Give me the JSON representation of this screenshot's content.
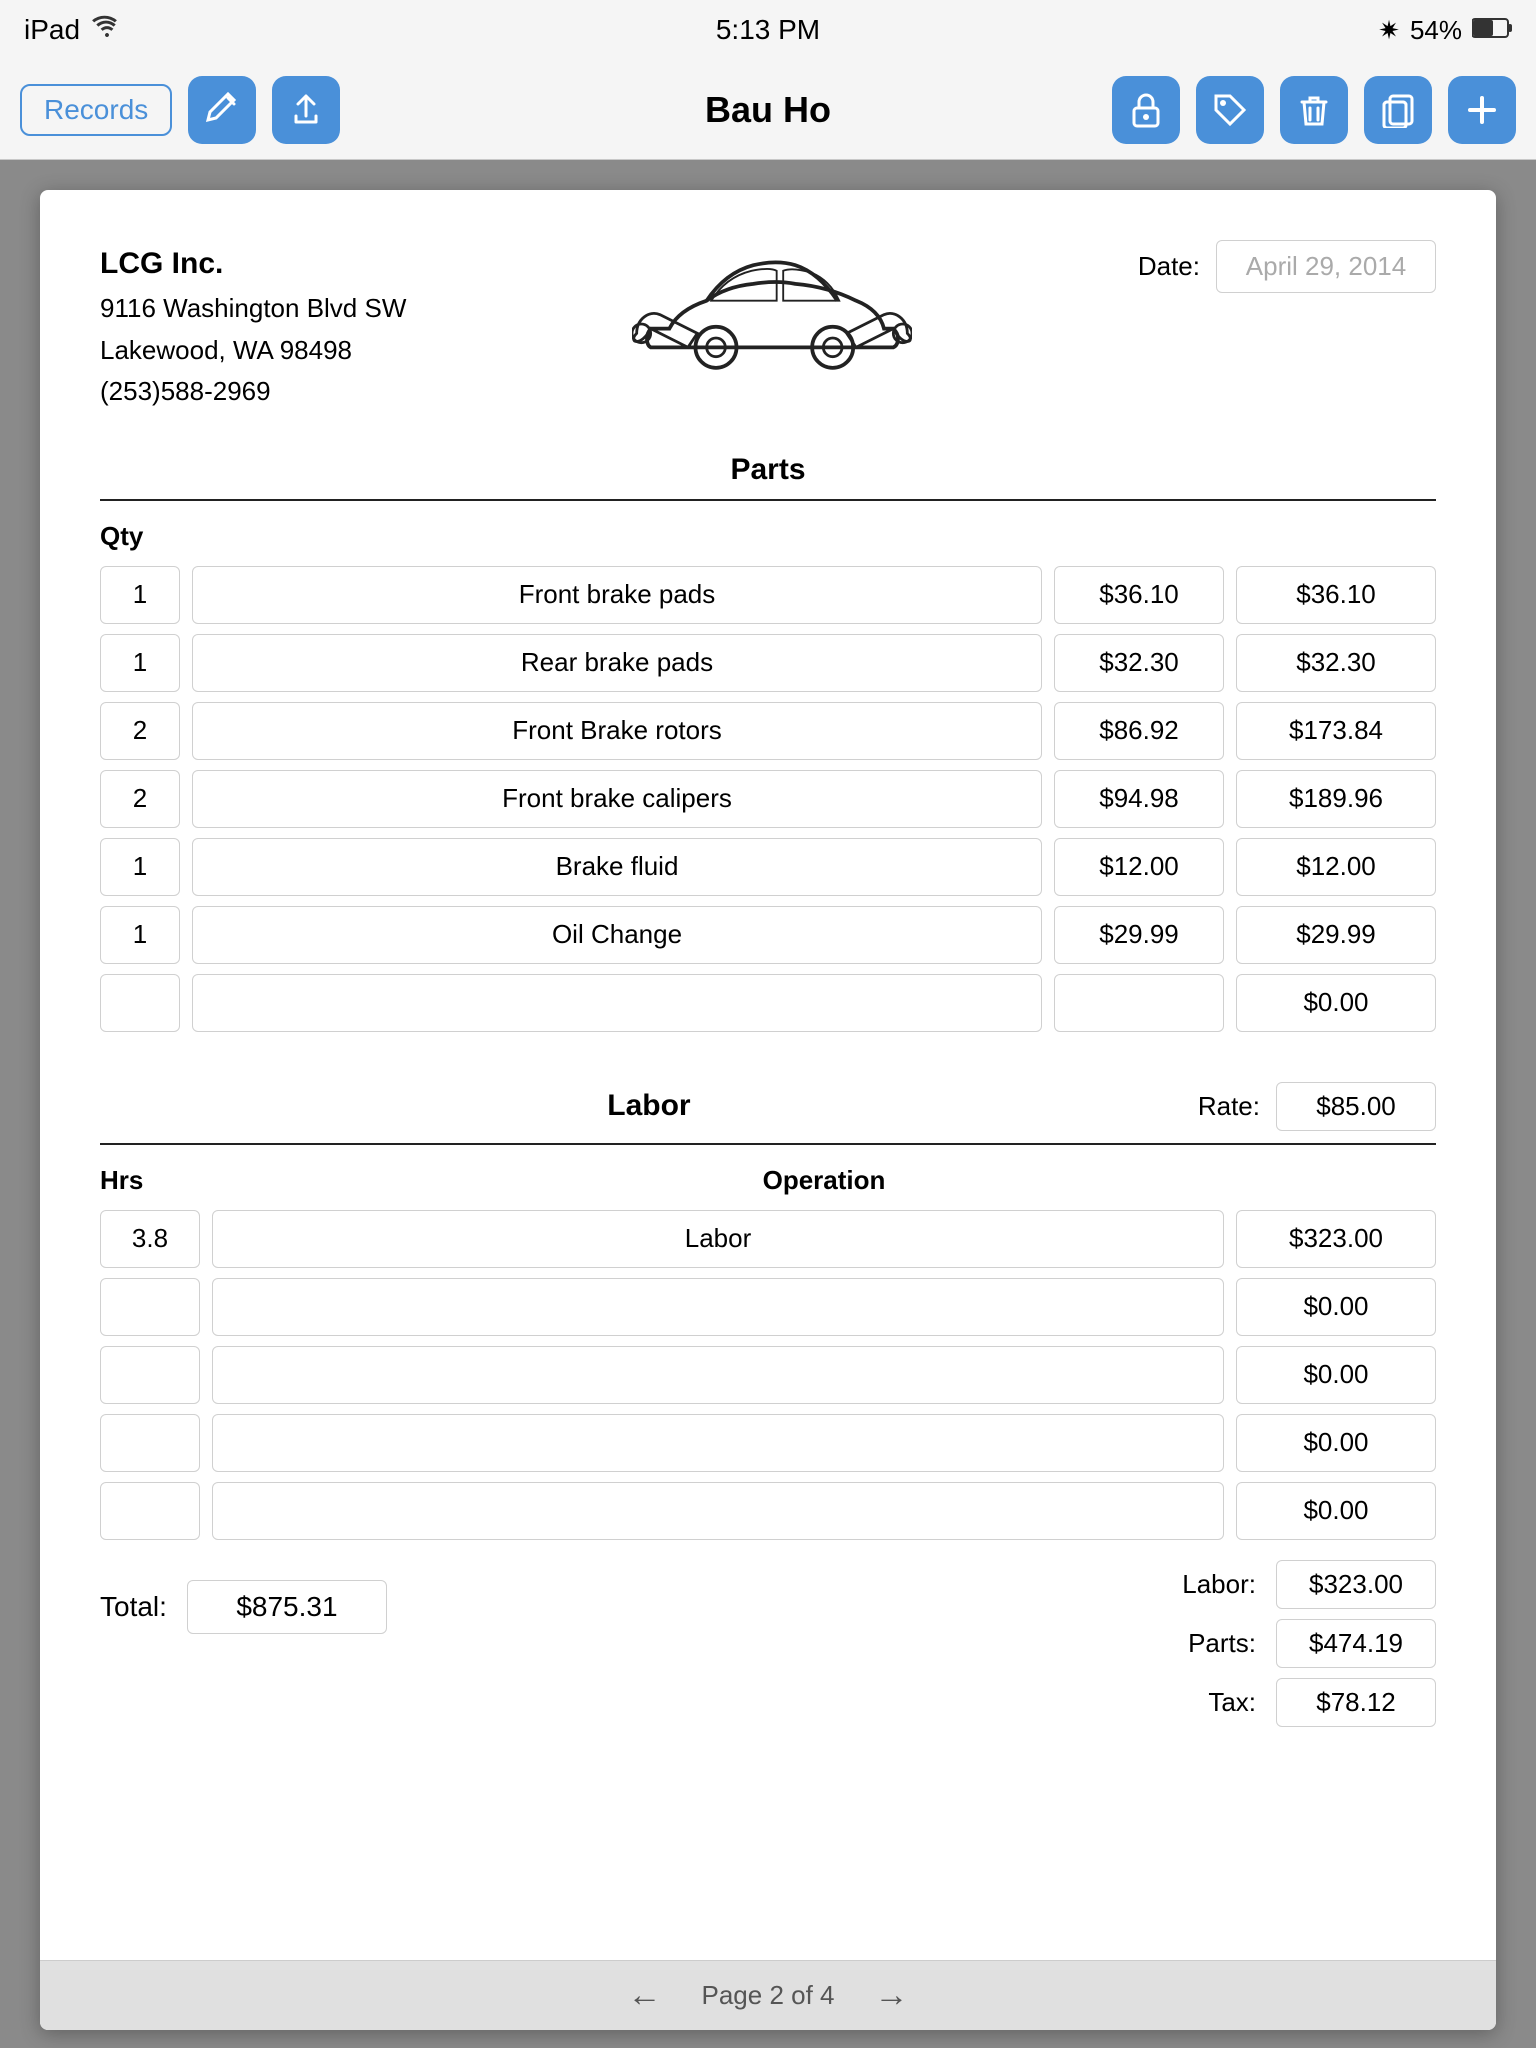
{
  "status": {
    "device": "iPad",
    "wifi": true,
    "time": "5:13 PM",
    "bluetooth": true,
    "battery": "54%"
  },
  "nav": {
    "records_label": "Records",
    "title": "Bau Ho"
  },
  "company": {
    "name": "LCG Inc.",
    "address_line1": "9116 Washington Blvd SW",
    "address_line2": "Lakewood, WA  98498",
    "phone": "(253)588-2969"
  },
  "date_label": "Date:",
  "date_value": "April 29, 2014",
  "parts_title": "Parts",
  "qty_header": "Qty",
  "parts": [
    {
      "qty": "1",
      "desc": "Front brake pads",
      "unit": "$36.10",
      "total": "$36.10"
    },
    {
      "qty": "1",
      "desc": "Rear brake pads",
      "unit": "$32.30",
      "total": "$32.30"
    },
    {
      "qty": "2",
      "desc": "Front Brake rotors",
      "unit": "$86.92",
      "total": "$173.84"
    },
    {
      "qty": "2",
      "desc": "Front brake calipers",
      "unit": "$94.98",
      "total": "$189.96"
    },
    {
      "qty": "1",
      "desc": "Brake fluid",
      "unit": "$12.00",
      "total": "$12.00"
    },
    {
      "qty": "1",
      "desc": "Oil Change",
      "unit": "$29.99",
      "total": "$29.99"
    },
    {
      "qty": "",
      "desc": "",
      "unit": "",
      "total": "$0.00"
    }
  ],
  "labor_title": "Labor",
  "rate_label": "Rate:",
  "rate_value": "$85.00",
  "hrs_header": "Hrs",
  "op_header": "Operation",
  "labor_rows": [
    {
      "hrs": "3.8",
      "op": "Labor",
      "total": "$323.00"
    },
    {
      "hrs": "",
      "op": "",
      "total": "$0.00"
    },
    {
      "hrs": "",
      "op": "",
      "total": "$0.00"
    },
    {
      "hrs": "",
      "op": "",
      "total": "$0.00"
    },
    {
      "hrs": "",
      "op": "",
      "total": "$0.00"
    }
  ],
  "summary": {
    "total_label": "Total:",
    "total_value": "$875.31",
    "labor_label": "Labor:",
    "labor_value": "$323.00",
    "parts_label": "Parts:",
    "parts_value": "$474.19",
    "tax_label": "Tax:",
    "tax_value": "$78.12"
  },
  "pagination": {
    "label": "Page 2 of 4"
  }
}
